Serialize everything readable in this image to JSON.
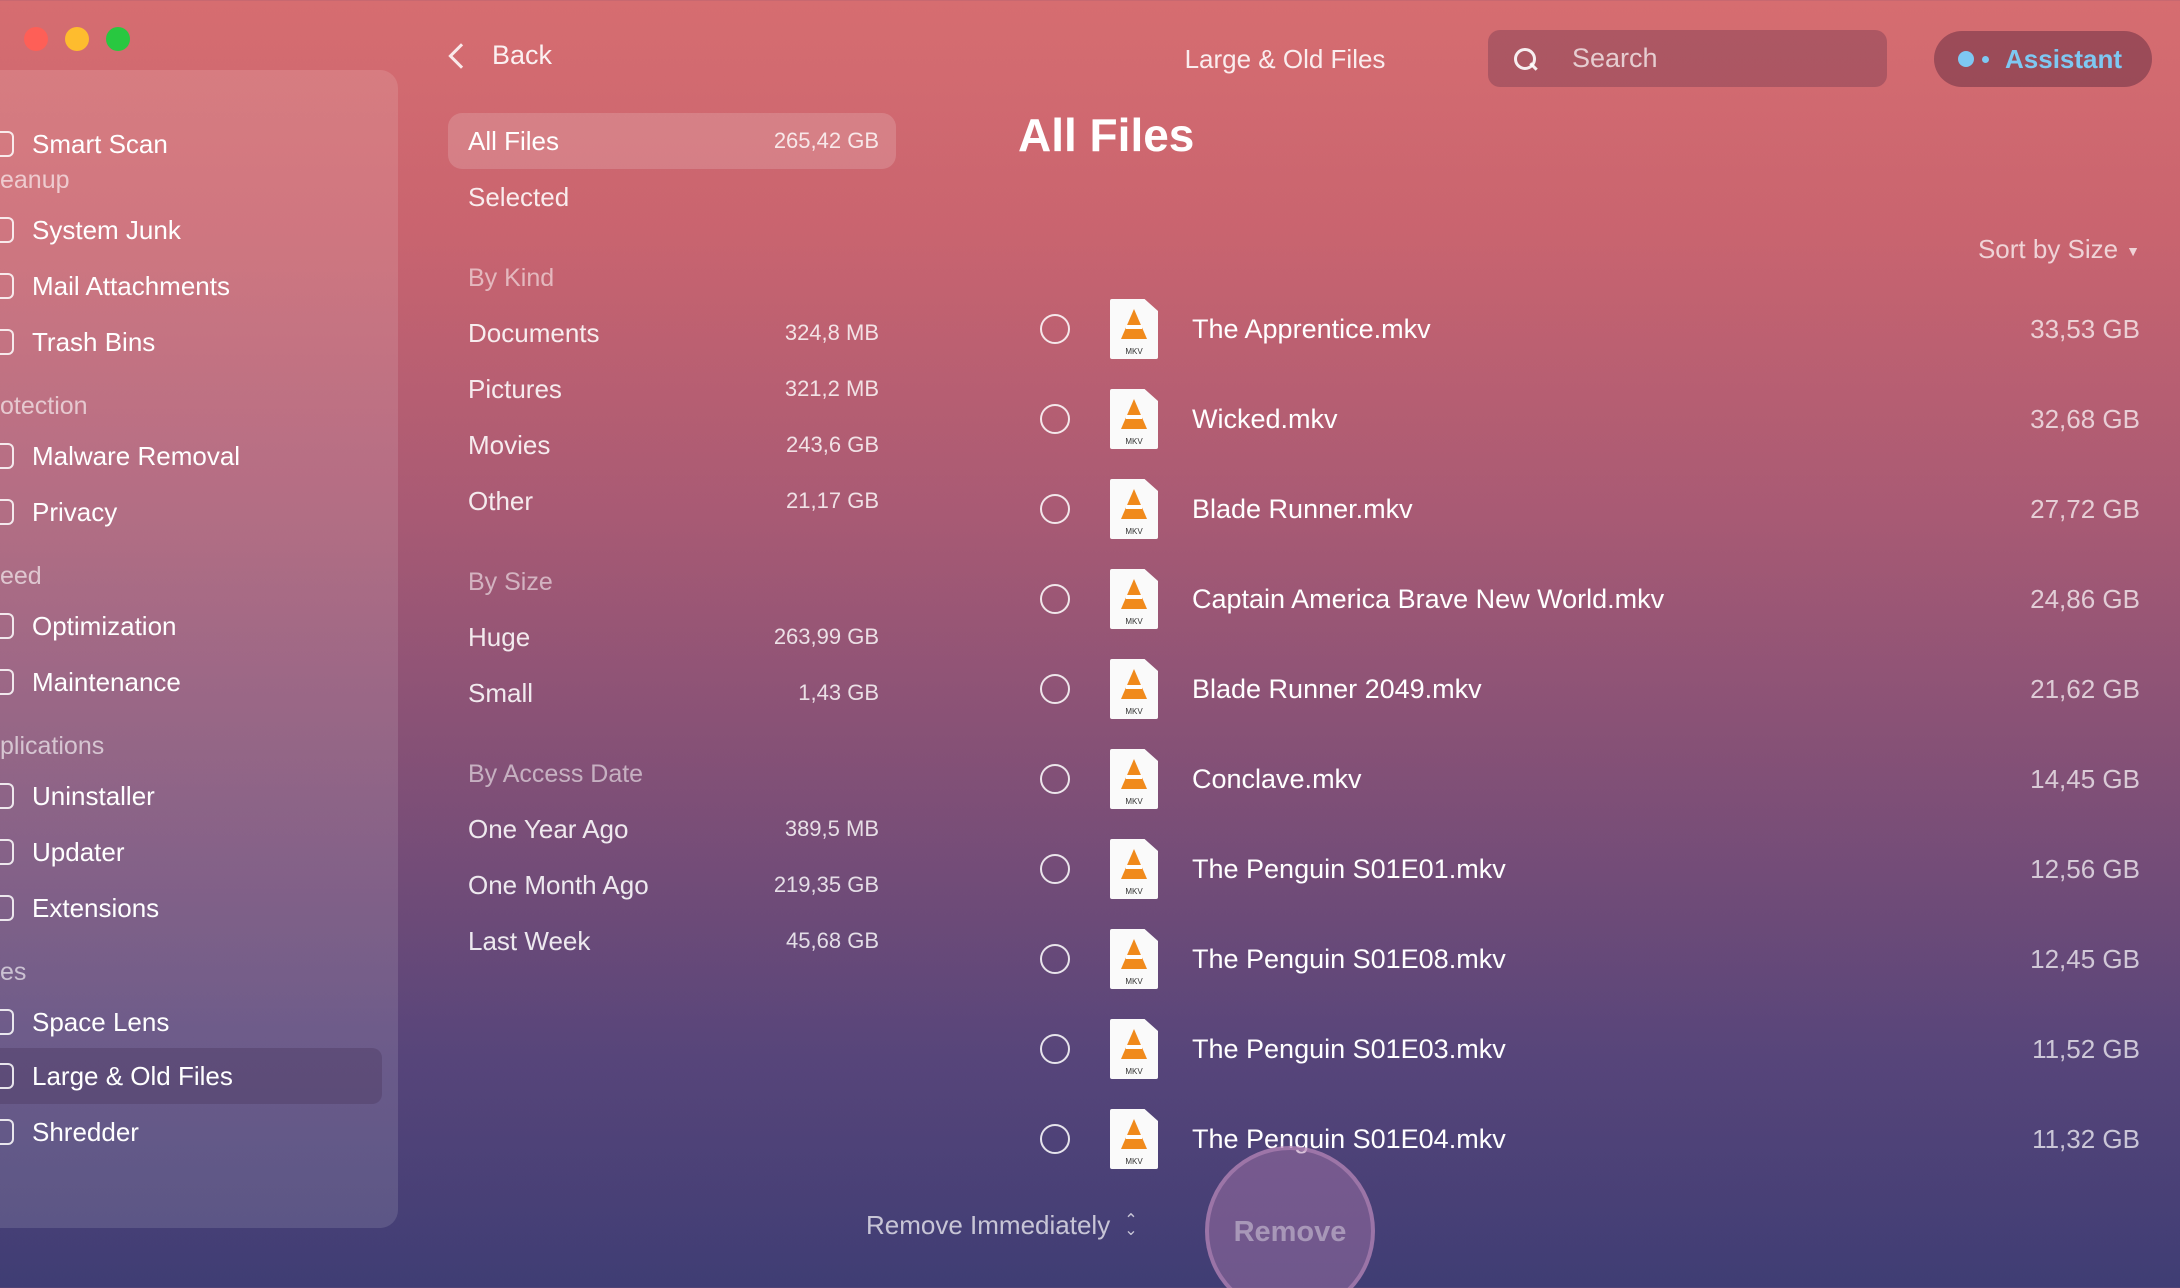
{
  "window": {
    "title": "Large & Old Files"
  },
  "toolbar": {
    "back_label": "Back",
    "search_placeholder": "Search",
    "assistant_label": "Assistant"
  },
  "sidebar": {
    "items": [
      {
        "label": "Smart Scan",
        "type": "item",
        "icon": "smart-scan-icon"
      },
      {
        "label": "eanup",
        "type": "section"
      },
      {
        "label": "System Junk",
        "type": "item",
        "icon": "system-junk-icon"
      },
      {
        "label": "Mail Attachments",
        "type": "item",
        "icon": "mail-attachments-icon"
      },
      {
        "label": "Trash Bins",
        "type": "item",
        "icon": "trash-bins-icon"
      },
      {
        "label": "otection",
        "type": "section"
      },
      {
        "label": "Malware Removal",
        "type": "item",
        "icon": "malware-removal-icon"
      },
      {
        "label": "Privacy",
        "type": "item",
        "icon": "privacy-icon"
      },
      {
        "label": "eed",
        "type": "section"
      },
      {
        "label": "Optimization",
        "type": "item",
        "icon": "optimization-icon"
      },
      {
        "label": "Maintenance",
        "type": "item",
        "icon": "maintenance-icon"
      },
      {
        "label": "plications",
        "type": "section"
      },
      {
        "label": "Uninstaller",
        "type": "item",
        "icon": "uninstaller-icon"
      },
      {
        "label": "Updater",
        "type": "item",
        "icon": "updater-icon"
      },
      {
        "label": "Extensions",
        "type": "item",
        "icon": "extensions-icon"
      },
      {
        "label": "es",
        "type": "section"
      },
      {
        "label": "Space Lens",
        "type": "item",
        "icon": "space-lens-icon"
      },
      {
        "label": "Large & Old Files",
        "type": "item",
        "icon": "large-old-files-icon",
        "active": true
      },
      {
        "label": "Shredder",
        "type": "item",
        "icon": "shredder-icon"
      }
    ]
  },
  "categories": {
    "all_files": {
      "label": "All Files",
      "size": "265,42 GB"
    },
    "selected": {
      "label": "Selected"
    },
    "by_kind": {
      "heading": "By Kind",
      "items": [
        {
          "label": "Documents",
          "size": "324,8 MB"
        },
        {
          "label": "Pictures",
          "size": "321,2 MB"
        },
        {
          "label": "Movies",
          "size": "243,6 GB"
        },
        {
          "label": "Other",
          "size": "21,17 GB"
        }
      ]
    },
    "by_size": {
      "heading": "By Size",
      "items": [
        {
          "label": "Huge",
          "size": "263,99 GB"
        },
        {
          "label": "Small",
          "size": "1,43 GB"
        }
      ]
    },
    "by_access_date": {
      "heading": "By Access Date",
      "items": [
        {
          "label": "One Year Ago",
          "size": "389,5 MB"
        },
        {
          "label": "One Month Ago",
          "size": "219,35 GB"
        },
        {
          "label": "Last Week",
          "size": "45,68 GB"
        }
      ]
    }
  },
  "main": {
    "title": "All Files",
    "sort_label": "Sort by Size",
    "file_icon_label": "MKV",
    "files": [
      {
        "name": "The Apprentice.mkv",
        "size": "33,53 GB"
      },
      {
        "name": "Wicked.mkv",
        "size": "32,68 GB"
      },
      {
        "name": "Blade Runner.mkv",
        "size": "27,72 GB"
      },
      {
        "name": "Captain America Brave New World.mkv",
        "size": "24,86 GB"
      },
      {
        "name": "Blade Runner 2049.mkv",
        "size": "21,62 GB"
      },
      {
        "name": "Conclave.mkv",
        "size": "14,45 GB"
      },
      {
        "name": "The Penguin S01E01.mkv",
        "size": "12,56 GB"
      },
      {
        "name": "The Penguin S01E08.mkv",
        "size": "12,45 GB"
      },
      {
        "name": "The Penguin S01E03.mkv",
        "size": "11,52 GB"
      },
      {
        "name": "The Penguin S01E04.mkv",
        "size": "11,32 GB"
      }
    ]
  },
  "footer": {
    "remove_mode": "Remove Immediately",
    "remove_label": "Remove"
  }
}
